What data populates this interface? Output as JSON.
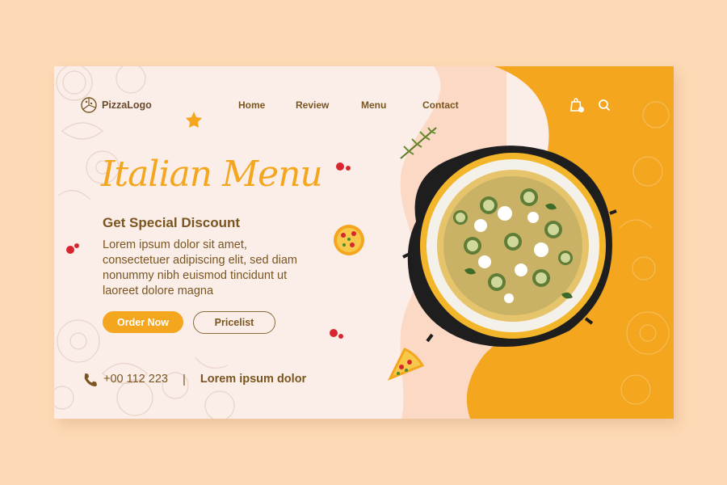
{
  "brand": {
    "logo_text": "PizzaLogo"
  },
  "nav": {
    "items": [
      "Home",
      "Review",
      "Menu",
      "Contact"
    ]
  },
  "icons": {
    "cart": "shopping-bag-icon",
    "search": "search-icon",
    "phone": "phone-icon",
    "logo": "pizza-logo-icon"
  },
  "hero": {
    "title": "Italian Menu",
    "subtitle": "Get Special Discount",
    "body": "Lorem ipsum dolor sit amet, consectetuer adipiscing elit, sed diam nonummy nibh euismod tincidunt ut laoreet dolore magna",
    "order_button": "Order Now",
    "pricelist_button": "Pricelist"
  },
  "footer": {
    "phone": "+00 112 223",
    "separator": "|",
    "text": "Lorem ipsum dolor"
  },
  "colors": {
    "accent": "#f3a61e",
    "text": "#7a5520",
    "background": "#fbeee9",
    "page": "#fdd9b5"
  }
}
